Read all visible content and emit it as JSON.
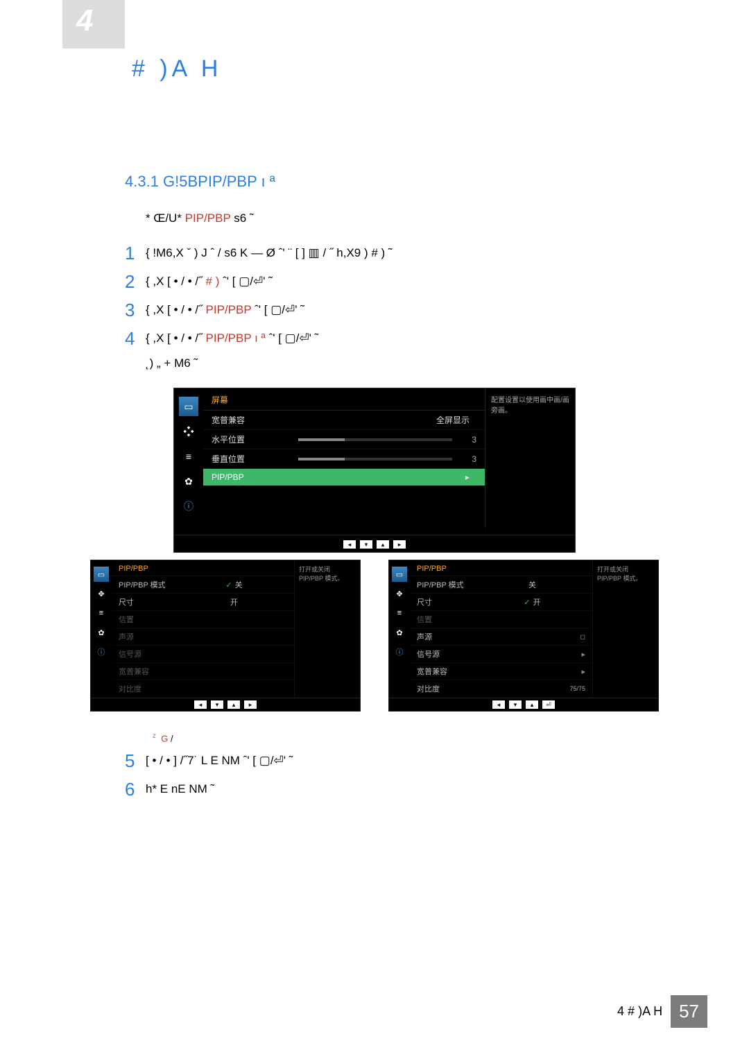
{
  "header": {
    "chapter_title": "# )A  H",
    "big4": "4"
  },
  "section": {
    "num_title": "4.3.1   G!5BPIP/PBP ı ª"
  },
  "intro": {
    "pre": "* Œ/U*   ",
    "colored": "PIP/PBP",
    "post": "  s6  ˜"
  },
  "steps": [
    {
      "num": "1",
      "text": "{  !M6,X ˇ )  J ˆ / s6 K  — Ø ˆ'  ¨  [     ]          ▥   / ˝ h,X9  ) # ) ˜"
    },
    {
      "num": "2",
      "text_pre": "{   ,X [       • / •   /˝   ",
      "colored": "# )",
      "text_post": " ˆ'   [      ▢/⏎' ˜"
    },
    {
      "num": "3",
      "text_pre": "{   ,X [       • / •   /˝   ",
      "colored": "PIP/PBP",
      "text_post": " ˆ'   [      ▢/⏎' ˜"
    },
    {
      "num": "4",
      "text_pre": "{   ,X [       • / •   /˝   ",
      "colored": "PIP/PBP  ı ª",
      "text_post": " ˆ'     [       ▢/⏎' ˜"
    },
    {
      "num": "5",
      "text": "[ • / • ] /˝7˙ L E NM ˆ'    [       ▢/⏎' ˜"
    },
    {
      "num": "6",
      "text": "h* E  nE NM ˜"
    }
  ],
  "sublabel": "˛)  „  + M6 ˜",
  "osd_main": {
    "title": "屏幕",
    "help": "配置设置以使用画中画/画旁画。",
    "rows": [
      {
        "label": "宽普兼容",
        "val": "全屏显示"
      },
      {
        "label": "水平位置",
        "bar": true,
        "num": "3"
      },
      {
        "label": "垂直位置",
        "bar": true,
        "num": "3"
      },
      {
        "label": "PIP/PBP",
        "selected": true,
        "arrow": "▸"
      }
    ]
  },
  "osd_left": {
    "title": "PIP/PBP",
    "help": "打开或关闭 PIP/PBP 模式。",
    "rows": [
      {
        "lbl": "PIP/PBP 模式",
        "v": "关",
        "checked": true,
        "sel": true
      },
      {
        "lbl": "尺寸",
        "v": "开",
        "disabled": true
      },
      {
        "lbl": "信置",
        "disabled": true
      },
      {
        "lbl": "声源",
        "disabled": true
      },
      {
        "lbl": "信号源",
        "disabled": true
      },
      {
        "lbl": "宽普兼容",
        "disabled": true
      },
      {
        "lbl": "对比度",
        "disabled": true
      }
    ]
  },
  "osd_right": {
    "title": "PIP/PBP",
    "help": "打开或关闭 PIP/PBP 模式。",
    "rows": [
      {
        "lbl": "PIP/PBP 模式",
        "v": "关"
      },
      {
        "lbl": "尺寸",
        "v": "开",
        "checked": true,
        "sel": true
      },
      {
        "lbl": "信置",
        "disabled": true
      },
      {
        "lbl": "声源",
        "sq": "◻"
      },
      {
        "lbl": "信号源",
        "arrow": "▸"
      },
      {
        "lbl": "宽普兼容",
        "arrow": "▸"
      },
      {
        "lbl": "对比度",
        "pair": "75/75"
      }
    ]
  },
  "footnote": {
    "mark": "z",
    "colored": "G",
    "post": " /"
  },
  "footer": {
    "chap": "4 # )A  H",
    "page": "57"
  }
}
